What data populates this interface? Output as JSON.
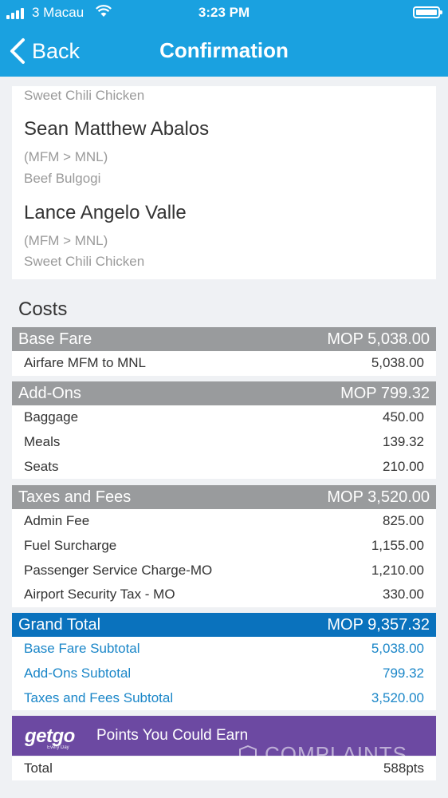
{
  "status_bar": {
    "carrier": "3 Macau",
    "time": "3:23 PM"
  },
  "nav": {
    "back_label": "Back",
    "title": "Confirmation"
  },
  "passengers": {
    "first_meal": "Sweet Chili Chicken",
    "list": [
      {
        "name": "Sean Matthew Abalos",
        "route": "(MFM > MNL)",
        "meal": "Beef Bulgogi"
      },
      {
        "name": "Lance Angelo Valle",
        "route": "(MFM > MNL)",
        "meal": "Sweet Chili Chicken"
      }
    ]
  },
  "costs": {
    "title": "Costs",
    "base_fare": {
      "label": "Base Fare",
      "amount": "MOP 5,038.00",
      "items": [
        {
          "label": "Airfare MFM to MNL",
          "value": "5,038.00"
        }
      ]
    },
    "add_ons": {
      "label": "Add-Ons",
      "amount": "MOP 799.32",
      "items": [
        {
          "label": "Baggage",
          "value": "450.00"
        },
        {
          "label": "Meals",
          "value": "139.32"
        },
        {
          "label": "Seats",
          "value": "210.00"
        }
      ]
    },
    "taxes": {
      "label": "Taxes and Fees",
      "amount": "MOP 3,520.00",
      "items": [
        {
          "label": "Admin Fee",
          "value": "825.00"
        },
        {
          "label": "Fuel Surcharge",
          "value": "1,155.00"
        },
        {
          "label": "Passenger Service Charge-MO",
          "value": "1,210.00"
        },
        {
          "label": "Airport Security Tax - MO",
          "value": "330.00"
        }
      ]
    },
    "grand_total": {
      "label": "Grand Total",
      "amount": "MOP 9,357.32",
      "items": [
        {
          "label": "Base Fare Subtotal",
          "value": "5,038.00"
        },
        {
          "label": "Add-Ons Subtotal",
          "value": "799.32"
        },
        {
          "label": "Taxes and Fees Subtotal",
          "value": "3,520.00"
        }
      ]
    }
  },
  "points": {
    "logo": "getgo",
    "logo_tagline": "Every Day",
    "heading": "Points You Could Earn",
    "total_label": "Total",
    "total_value": "588pts"
  },
  "watermark": "COMPLAINTS",
  "colors": {
    "nav_blue": "#1aa1e0",
    "header_gray": "#999b9d",
    "total_blue": "#0a72bd",
    "getgo_purple": "#6c49a2",
    "link_blue": "#1a86c8"
  }
}
